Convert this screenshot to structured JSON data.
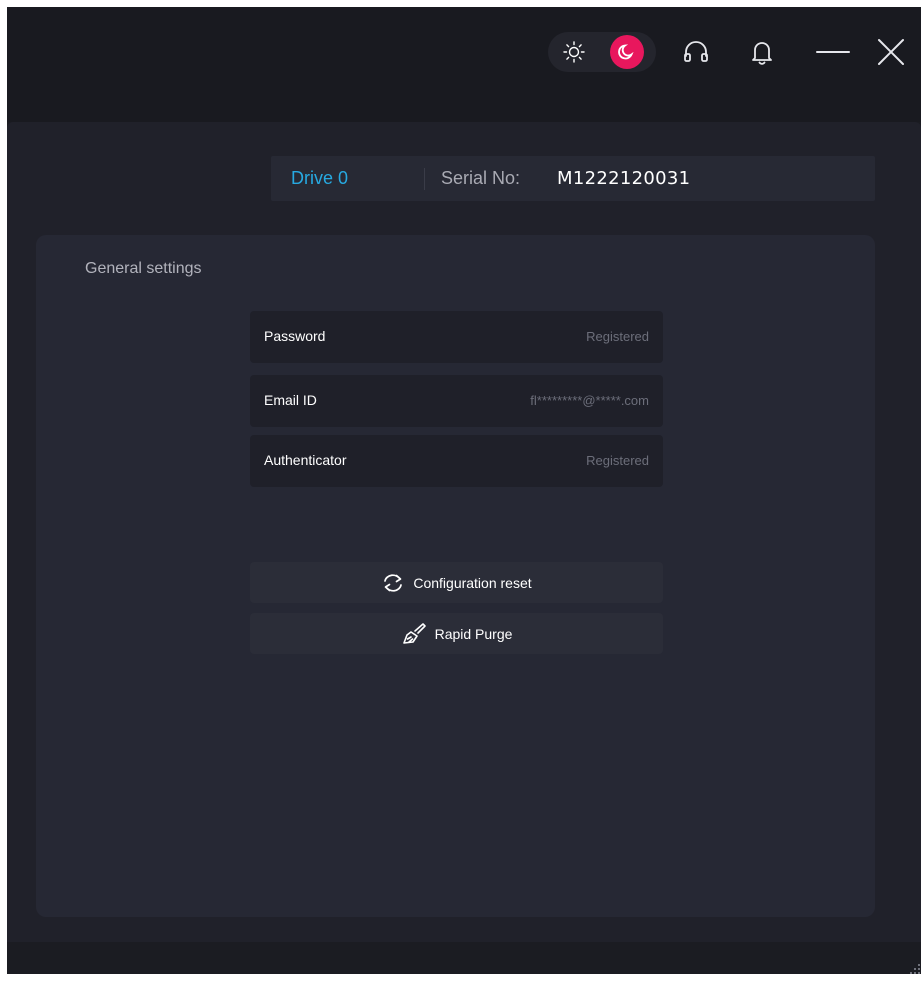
{
  "titlebar": {
    "theme_toggle": {
      "options": [
        "light",
        "dark"
      ],
      "selected": "dark",
      "light_icon": "sun-icon",
      "dark_icon": "moon-icon",
      "accent_color": "#e8175d"
    },
    "icons": [
      "headset-icon",
      "bell-icon",
      "minimize-icon",
      "close-icon"
    ]
  },
  "drive_bar": {
    "drive_label": "Drive 0",
    "serial_label": "Serial No:",
    "serial_value": "M1222120031",
    "drive_color": "#27a9e1"
  },
  "general_settings": {
    "title": "General settings",
    "rows": [
      {
        "label": "Password",
        "value": "Registered"
      },
      {
        "label": "Email ID",
        "value": "fl*********@*****.com"
      },
      {
        "label": "Authenticator",
        "value": "Registered"
      }
    ],
    "actions": [
      {
        "label": "Configuration reset",
        "icon": "refresh-icon"
      },
      {
        "label": "Rapid Purge",
        "icon": "brush-icon"
      }
    ]
  }
}
